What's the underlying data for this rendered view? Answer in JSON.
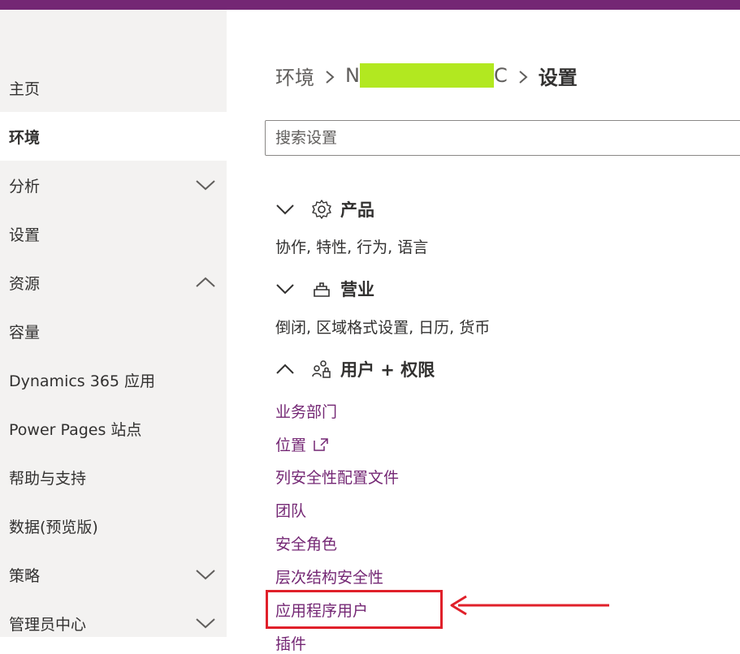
{
  "sidebar": {
    "items": [
      {
        "label": "主页"
      },
      {
        "label": "环境"
      },
      {
        "label": "分析"
      },
      {
        "label": "设置"
      },
      {
        "label": "资源"
      },
      {
        "label": "容量"
      },
      {
        "label": "Dynamics 365 应用"
      },
      {
        "label": "Power Pages 站点"
      },
      {
        "label": "帮助与支持"
      },
      {
        "label": "数据(预览版)"
      },
      {
        "label": "策略"
      },
      {
        "label": "管理员中心"
      }
    ],
    "active_item": "环境"
  },
  "breadcrumb": {
    "root": "环境",
    "env_prefix": "N",
    "env_suffix": "C",
    "current": "设置"
  },
  "search": {
    "placeholder": "搜索设置"
  },
  "sections": {
    "product": {
      "title": "产品",
      "desc": "协作, 特性, 行为, 语言",
      "icon": "gear-icon",
      "expanded": false
    },
    "business": {
      "title": "营业",
      "desc": "倒闭, 区域格式设置, 日历, 货币",
      "icon": "building-icon",
      "expanded": false
    },
    "users": {
      "title": "用户 + 权限",
      "icon": "people-lock-icon",
      "expanded": true,
      "links": [
        {
          "label": "业务部门"
        },
        {
          "label": "位置",
          "external": true
        },
        {
          "label": "列安全性配置文件"
        },
        {
          "label": "团队"
        },
        {
          "label": "安全角色"
        },
        {
          "label": "层次结构安全性"
        },
        {
          "label": "应用程序用户"
        },
        {
          "label": "插件"
        }
      ]
    }
  },
  "colors": {
    "topbar": "#742774",
    "sidebar_bg": "#f3f2f1",
    "link": "#742774",
    "redaction": "#b2e820",
    "annotation": "#e0202a"
  }
}
